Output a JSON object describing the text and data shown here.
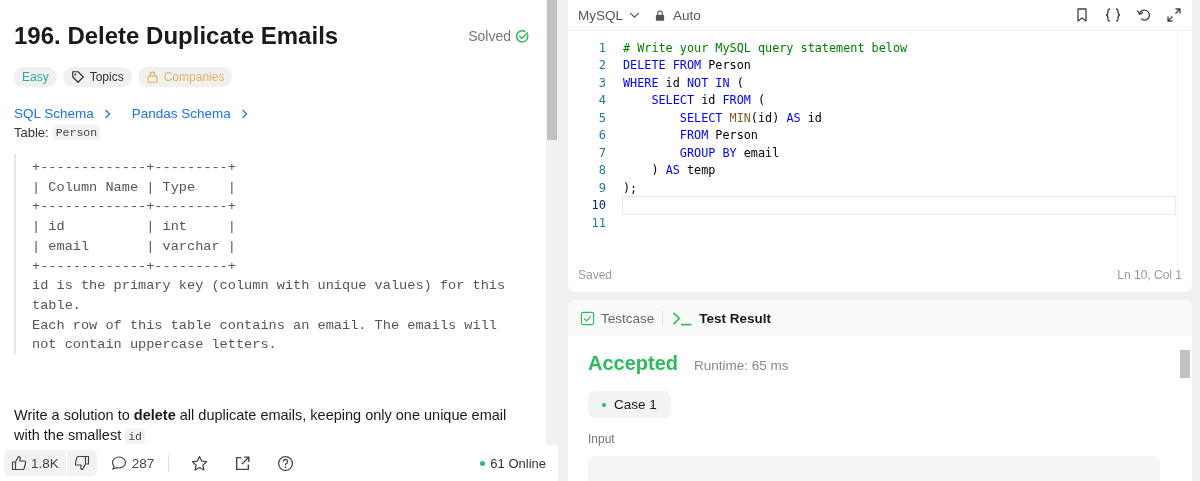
{
  "problem": {
    "title": "196. Delete Duplicate Emails",
    "status": "Solved",
    "solved": true,
    "tags": [
      {
        "kind": "difficulty",
        "label": "Easy"
      },
      {
        "kind": "topics",
        "label": "Topics"
      },
      {
        "kind": "locked",
        "label": "Companies"
      }
    ],
    "links": [
      "SQL Schema",
      "Pandas Schema"
    ],
    "table_label": "Table:",
    "table_name": "Person",
    "schema": "+-------------+---------+\n| Column Name | Type    |\n+-------------+---------+\n| id          | int     |\n| email       | varchar |\n+-------------+---------+\nid is the primary key (column with unique values) for this\ntable.\nEach row of this table contains an email. The emails will\nnot contain uppercase letters.",
    "description": [
      {
        "kind": "text",
        "text": "Write a solution to "
      },
      {
        "kind": "bold",
        "text": "delete"
      },
      {
        "kind": "text",
        "text": " all duplicate emails, keeping only one unique email with the smallest "
      },
      {
        "kind": "code",
        "text": "id"
      }
    ]
  },
  "footer": {
    "likes": "1.8K",
    "comments": "287",
    "online": "61 Online"
  },
  "editor": {
    "language": "MySQL",
    "mode": "Auto",
    "status": "Saved",
    "cursor": "Ln 10, Col 1",
    "lines": [
      {
        "number": "1",
        "current": false,
        "tokens": [
          {
            "kind": "comment",
            "text": "# Write your MySQL query statement below"
          }
        ]
      },
      {
        "number": "2",
        "current": false,
        "tokens": [
          {
            "kind": "keyword",
            "text": "DELETE FROM"
          },
          {
            "kind": "plain",
            "text": " Person"
          }
        ]
      },
      {
        "number": "3",
        "current": false,
        "tokens": [
          {
            "kind": "keyword",
            "text": "WHERE"
          },
          {
            "kind": "plain",
            "text": " id "
          },
          {
            "kind": "keyword",
            "text": "NOT IN"
          },
          {
            "kind": "plain",
            "text": " ("
          }
        ]
      },
      {
        "number": "4",
        "current": false,
        "tokens": [
          {
            "kind": "keyword",
            "text": "    SELECT"
          },
          {
            "kind": "plain",
            "text": " id "
          },
          {
            "kind": "keyword",
            "text": "FROM"
          },
          {
            "kind": "plain",
            "text": " ("
          }
        ]
      },
      {
        "number": "5",
        "current": false,
        "tokens": [
          {
            "kind": "keyword",
            "text": "        SELECT "
          },
          {
            "kind": "function",
            "text": "MIN"
          },
          {
            "kind": "plain",
            "text": "(id) "
          },
          {
            "kind": "keyword",
            "text": "AS"
          },
          {
            "kind": "plain",
            "text": " id"
          }
        ]
      },
      {
        "number": "6",
        "current": false,
        "tokens": [
          {
            "kind": "keyword",
            "text": "        FROM"
          },
          {
            "kind": "plain",
            "text": " Person"
          }
        ]
      },
      {
        "number": "7",
        "current": false,
        "tokens": [
          {
            "kind": "keyword",
            "text": "        GROUP BY"
          },
          {
            "kind": "plain",
            "text": " email"
          }
        ]
      },
      {
        "number": "8",
        "current": false,
        "tokens": [
          {
            "kind": "plain",
            "text": "    ) "
          },
          {
            "kind": "keyword",
            "text": "AS"
          },
          {
            "kind": "plain",
            "text": " temp"
          }
        ]
      },
      {
        "number": "9",
        "current": false,
        "tokens": [
          {
            "kind": "plain",
            "text": ");"
          }
        ]
      },
      {
        "number": "10",
        "current": true
      },
      {
        "number": "11",
        "current": false
      }
    ]
  },
  "result": {
    "tabs": [
      {
        "kind": "testcase",
        "label": "Testcase",
        "selected": false
      },
      {
        "kind": "result",
        "label": "Test Result",
        "selected": true
      }
    ],
    "verdict": "Accepted",
    "runtime": "Runtime: 65 ms",
    "cases": [
      {
        "label": "Case 1",
        "selected": true
      }
    ],
    "input_label": "Input"
  }
}
